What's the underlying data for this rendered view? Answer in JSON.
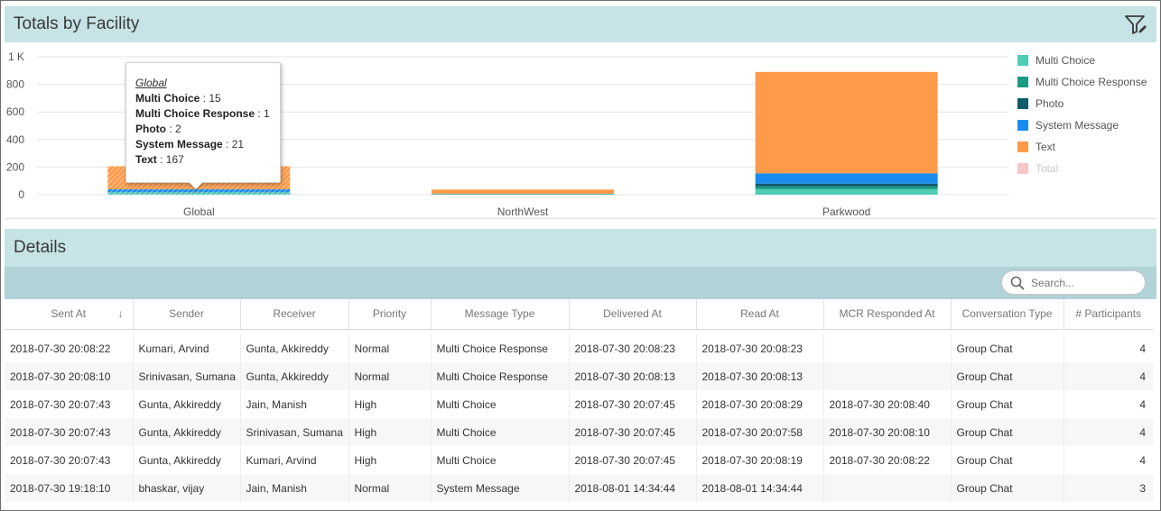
{
  "totals": {
    "title": "Totals by Facility",
    "filter_icon": "filter-edit-icon"
  },
  "chart_data": {
    "type": "bar",
    "stacked": true,
    "categories": [
      "Global",
      "NorthWest",
      "Parkwood"
    ],
    "series": [
      {
        "name": "Multi Choice",
        "color": "#4ecdb4",
        "values": [
          15,
          3,
          40
        ]
      },
      {
        "name": "Multi Choice Response",
        "color": "#1a9a82",
        "values": [
          1,
          1,
          20
        ]
      },
      {
        "name": "Photo",
        "color": "#0e5b6b",
        "values": [
          2,
          1,
          20
        ]
      },
      {
        "name": "System Message",
        "color": "#1a8cf0",
        "values": [
          21,
          2,
          75
        ]
      },
      {
        "name": "Text",
        "color": "#ff9a4a",
        "values": [
          167,
          30,
          735
        ]
      },
      {
        "name": "Total",
        "color": "#f6c6c9",
        "values": [],
        "hidden": true
      }
    ],
    "ylim": [
      0,
      1000
    ],
    "yticks": [
      0,
      200,
      400,
      600,
      800,
      1000
    ],
    "ytick_labels": [
      "0",
      "200",
      "400",
      "600",
      "800",
      "1 K"
    ],
    "grid": true,
    "legend": "right",
    "highlighted_category": 0
  },
  "tooltip": {
    "header": "Global",
    "rows": [
      {
        "label": "Multi Choice",
        "value": " : 15"
      },
      {
        "label": "Multi Choice Response",
        "value": " : 1"
      },
      {
        "label": "Photo",
        "value": " : 2"
      },
      {
        "label": "System Message",
        "value": " : 21"
      },
      {
        "label": "Text",
        "value": " : 167"
      }
    ]
  },
  "details": {
    "title": "Details",
    "search_placeholder": "Search...",
    "columns": [
      "Sent At",
      "Sender",
      "Receiver",
      "Priority",
      "Message Type",
      "Delivered At",
      "Read At",
      "MCR Responded At",
      "Conversation Type",
      "# Participants"
    ],
    "sort_indicator": "↓",
    "rows": [
      [
        "2018-07-30 20:08:22",
        "Kumari, Arvind",
        "Gunta, Akkireddy",
        "Normal",
        "Multi Choice Response",
        "2018-07-30 20:08:23",
        "2018-07-30 20:08:23",
        "",
        "Group Chat",
        "4"
      ],
      [
        "2018-07-30 20:08:10",
        "Srinivasan, Sumana",
        "Gunta, Akkireddy",
        "Normal",
        "Multi Choice Response",
        "2018-07-30 20:08:13",
        "2018-07-30 20:08:13",
        "",
        "Group Chat",
        "4"
      ],
      [
        "2018-07-30 20:07:43",
        "Gunta, Akkireddy",
        "Jain, Manish",
        "High",
        "Multi Choice",
        "2018-07-30 20:07:45",
        "2018-07-30 20:08:29",
        "2018-07-30 20:08:40",
        "Group Chat",
        "4"
      ],
      [
        "2018-07-30 20:07:43",
        "Gunta, Akkireddy",
        "Srinivasan, Sumana",
        "High",
        "Multi Choice",
        "2018-07-30 20:07:45",
        "2018-07-30 20:07:58",
        "2018-07-30 20:08:10",
        "Group Chat",
        "4"
      ],
      [
        "2018-07-30 20:07:43",
        "Gunta, Akkireddy",
        "Kumari, Arvind",
        "High",
        "Multi Choice",
        "2018-07-30 20:07:45",
        "2018-07-30 20:08:19",
        "2018-07-30 20:08:22",
        "Group Chat",
        "4"
      ],
      [
        "2018-07-30 19:18:10",
        "bhaskar, vijay",
        "Jain, Manish",
        "Normal",
        "System Message",
        "2018-08-01 14:34:44",
        "2018-08-01 14:34:44",
        "",
        "Group Chat",
        "3"
      ]
    ]
  }
}
